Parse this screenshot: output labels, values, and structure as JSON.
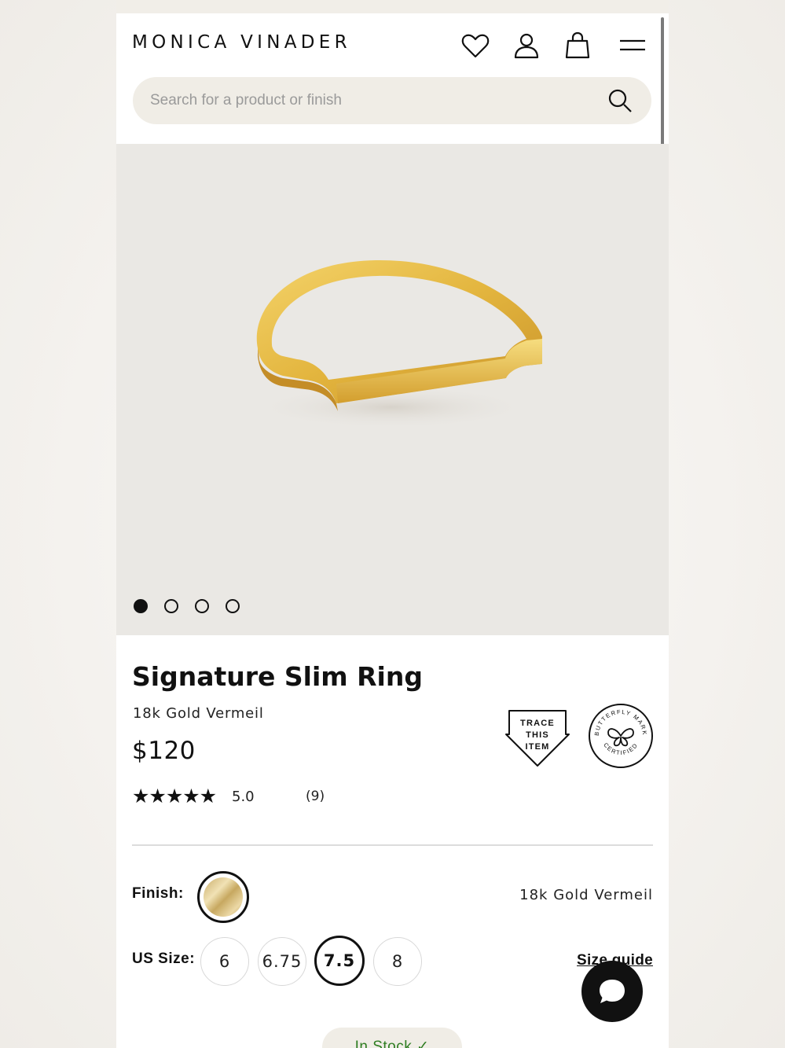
{
  "header": {
    "logo": "MONICA VINADER",
    "icons": [
      "heart-icon",
      "user-icon",
      "bag-icon",
      "menu-icon"
    ]
  },
  "search": {
    "placeholder": "Search for a product or finish"
  },
  "gallery": {
    "image_count": 4,
    "active_index": 0
  },
  "product": {
    "name": "Signature Slim Ring",
    "material": "18k Gold Vermeil",
    "price": "$120",
    "stars": "★★★★★",
    "rating": "5.0",
    "reviews": "(9)"
  },
  "badges": {
    "trace_lines": [
      "TRACE",
      "THIS",
      "ITEM"
    ],
    "butterfly_top": "BUTTERFLY MARK",
    "butterfly_bottom": "CERTIFIED"
  },
  "finish": {
    "label": "Finish:",
    "selected": "18k Gold Vermeil"
  },
  "size": {
    "label": "US Size:",
    "options": [
      "6",
      "6.75",
      "7.5",
      "8"
    ],
    "selected": "7.5",
    "guide_label": "Size guide"
  },
  "stock": {
    "label": "In Stock ✓",
    "color": "#2e7d22"
  },
  "colors": {
    "search_bg": "#f0ede6",
    "gallery_bg": "#eae8e4",
    "gold": "#e0b33c"
  }
}
